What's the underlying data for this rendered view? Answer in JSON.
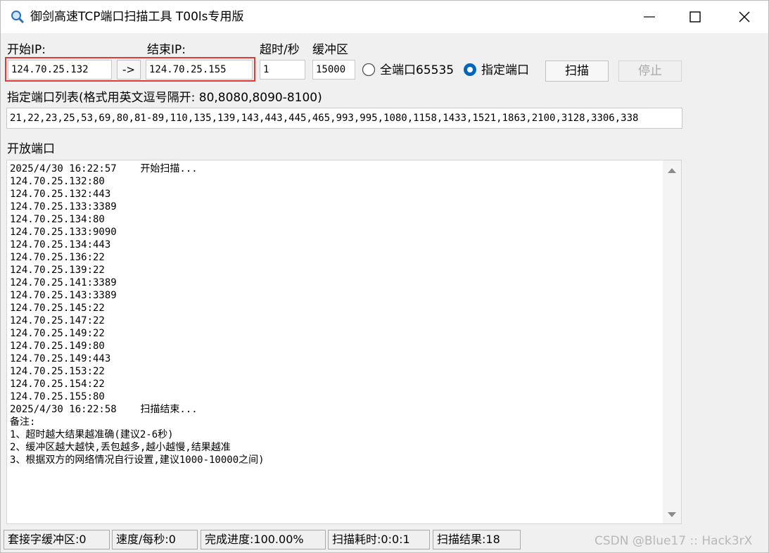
{
  "window": {
    "title": "御剑高速TCP端口扫描工具 T00ls专用版"
  },
  "form": {
    "start_ip_label": "开始IP:",
    "start_ip_value": "124.70.25.132",
    "arrow_label": "->",
    "end_ip_label": "结束IP:",
    "end_ip_value": "124.70.25.155",
    "timeout_label": "超时/秒",
    "timeout_value": "1",
    "buffer_label": "缓冲区",
    "buffer_value": "15000",
    "all_ports_label": "全端口65535",
    "all_ports_selected": false,
    "specified_ports_label": "指定端口",
    "specified_ports_selected": true,
    "scan_button": "扫描",
    "stop_button": "停止",
    "port_list_label": "指定端口列表(格式用英文逗号隔开: 80,8080,8090-8100)",
    "port_list_value": "21,22,23,25,53,69,80,81-89,110,135,139,143,443,445,465,993,995,1080,1158,1433,1521,1863,2100,3128,3306,338",
    "open_ports_label": "开放端口"
  },
  "log": [
    "2025/4/30 16:22:57    开始扫描...",
    "124.70.25.132:80",
    "124.70.25.132:443",
    "124.70.25.133:3389",
    "124.70.25.134:80",
    "124.70.25.133:9090",
    "124.70.25.134:443",
    "124.70.25.136:22",
    "124.70.25.139:22",
    "124.70.25.141:3389",
    "124.70.25.143:3389",
    "124.70.25.145:22",
    "124.70.25.147:22",
    "124.70.25.149:22",
    "124.70.25.149:80",
    "124.70.25.149:443",
    "124.70.25.153:22",
    "124.70.25.154:22",
    "124.70.25.155:80",
    "2025/4/30 16:22:58    扫描结束...",
    "备注:",
    "1、超时越大结果越准确(建议2-6秒)",
    "2、缓冲区越大越快,丢包越多,越小越慢,结果越准",
    "3、根据双方的网络情况自行设置,建议1000-10000之间)"
  ],
  "status": {
    "socket_buffer": "套接字缓冲区:0",
    "speed": "速度/每秒:0",
    "progress": "完成进度:100.00%",
    "elapsed": "扫描耗时:0:0:1",
    "results": "扫描结果:18"
  },
  "watermark": "CSDN @Blue17 :: Hack3rX",
  "colors": {
    "highlight_box": "#e03a3a",
    "radio_selected": "#0067c0"
  },
  "icons": {
    "app": "magnifier-icon",
    "minimize": "minimize-icon",
    "maximize": "maximize-icon",
    "close": "close-icon"
  }
}
